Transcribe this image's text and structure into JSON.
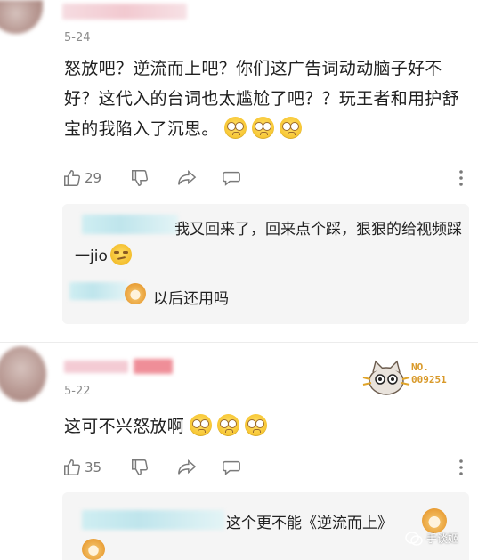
{
  "comments": [
    {
      "date": "5-24",
      "text": "怒放吧？逆流而上吧？你们这广告词动动脑子好不好？这代入的台词也太尴尬了吧？？玩王者和用护舒宝的我陷入了沉思。",
      "emoji_count": 3,
      "likes": "29",
      "replies": [
        {
          "text": "我又回来了，回来点个踩，狠狠的给视频踩一jio",
          "emoji": "smirk-emoji"
        },
        {
          "text": "以后还用吗",
          "emoji": "doge-emoji"
        }
      ]
    },
    {
      "date": "5-22",
      "text": "这可不兴怒放啊",
      "emoji_count": 3,
      "likes": "35",
      "sticker_label": "NO.\n009251",
      "replies": [
        {
          "text": "这个更不能《逆流而上》",
          "emoji": "shiba-emoji"
        }
      ]
    }
  ],
  "watermark": "手谈姬",
  "colors": {
    "accent_pink": "#f3c3cc",
    "icon_gray": "#7a7a7a"
  }
}
